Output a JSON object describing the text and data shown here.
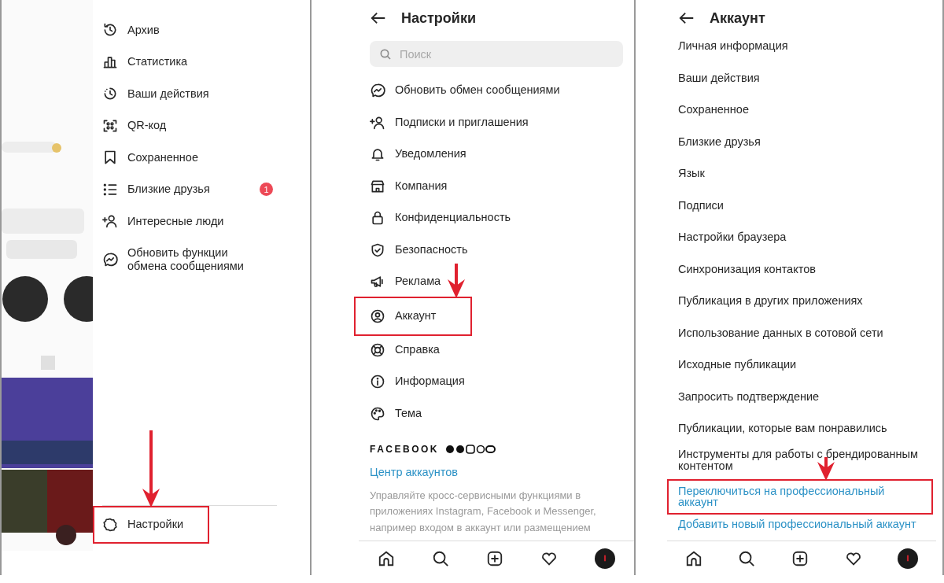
{
  "menu_panel": {
    "items": [
      {
        "label": "Архив"
      },
      {
        "label": "Статистика"
      },
      {
        "label": "Ваши действия"
      },
      {
        "label": "QR-код"
      },
      {
        "label": "Сохраненное"
      },
      {
        "label": "Близкие друзья",
        "badge": "1"
      },
      {
        "label": "Интересные люди"
      },
      {
        "label": "Обновить функции обмена сообщениями"
      }
    ],
    "settings_item": {
      "label": "Настройки",
      "highlighted": true
    }
  },
  "settings_panel": {
    "title": "Настройки",
    "search": {
      "placeholder": "Поиск"
    },
    "items": [
      {
        "label": "Обновить обмен сообщениями",
        "highlighted": false
      },
      {
        "label": "Подписки и приглашения",
        "highlighted": false
      },
      {
        "label": "Уведомления",
        "highlighted": false
      },
      {
        "label": "Компания",
        "highlighted": false
      },
      {
        "label": "Конфиденциальность",
        "highlighted": false
      },
      {
        "label": "Безопасность",
        "highlighted": false
      },
      {
        "label": "Реклама",
        "highlighted": false
      },
      {
        "label": "Аккаунт",
        "highlighted": true
      },
      {
        "label": "Справка",
        "highlighted": false
      },
      {
        "label": "Информация",
        "highlighted": false
      },
      {
        "label": "Тема",
        "highlighted": false
      }
    ],
    "facebook": {
      "brand": "FACEBOOK",
      "link": "Центр аккаунтов",
      "description": "Управляйте кросс-сервисными функциями в приложениях Instagram, Facebook и Messenger, например входом в аккаунт или размещением"
    }
  },
  "account_panel": {
    "title": "Аккаунт",
    "items": [
      {
        "label": "Личная информация",
        "kind": "plain",
        "highlighted": false
      },
      {
        "label": "Ваши действия",
        "kind": "plain",
        "highlighted": false
      },
      {
        "label": "Сохраненное",
        "kind": "plain",
        "highlighted": false
      },
      {
        "label": "Близкие друзья",
        "kind": "plain",
        "highlighted": false
      },
      {
        "label": "Язык",
        "kind": "plain",
        "highlighted": false
      },
      {
        "label": "Подписи",
        "kind": "plain",
        "highlighted": false
      },
      {
        "label": "Настройки браузера",
        "kind": "plain",
        "highlighted": false
      },
      {
        "label": "Синхронизация контактов",
        "kind": "plain",
        "highlighted": false
      },
      {
        "label": "Публикация в других приложениях",
        "kind": "plain",
        "highlighted": false
      },
      {
        "label": "Использование данных в сотовой сети",
        "kind": "plain",
        "highlighted": false
      },
      {
        "label": "Исходные публикации",
        "kind": "plain",
        "highlighted": false
      },
      {
        "label": "Запросить подтверждение",
        "kind": "plain",
        "highlighted": false
      },
      {
        "label": "Публикации, которые вам понравились",
        "kind": "plain",
        "highlighted": false
      },
      {
        "label": "Инструменты для работы с брендированным контентом",
        "kind": "plain",
        "highlighted": false
      },
      {
        "label": "Переключиться на профессиональный аккаунт",
        "kind": "link",
        "highlighted": true
      },
      {
        "label": "Добавить новый профессиональный аккаунт",
        "kind": "link",
        "highlighted": false
      }
    ]
  }
}
